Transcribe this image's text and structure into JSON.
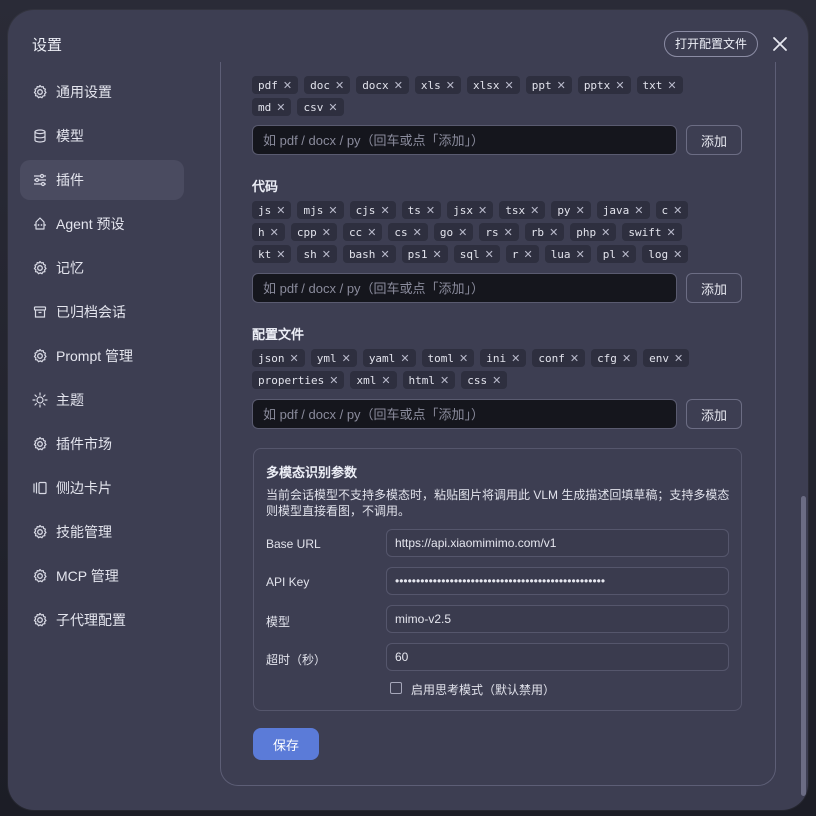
{
  "dialog": {
    "title": "设置",
    "open_config_label": "打开配置文件"
  },
  "sidebar": {
    "items": [
      {
        "label": "通用设置",
        "icon": "gear-icon"
      },
      {
        "label": "模型",
        "icon": "database-icon"
      },
      {
        "label": "插件",
        "icon": "sliders-icon",
        "active": true
      },
      {
        "label": "Agent 预设",
        "icon": "robot-icon"
      },
      {
        "label": "记忆",
        "icon": "gear-icon"
      },
      {
        "label": "已归档会话",
        "icon": "archive-icon"
      },
      {
        "label": "Prompt 管理",
        "icon": "gear-icon"
      },
      {
        "label": "主题",
        "icon": "sun-icon"
      },
      {
        "label": "插件市场",
        "icon": "gear-icon"
      },
      {
        "label": "侧边卡片",
        "icon": "cards-icon"
      },
      {
        "label": "技能管理",
        "icon": "gear-icon"
      },
      {
        "label": "MCP 管理",
        "icon": "gear-icon"
      },
      {
        "label": "子代理配置",
        "icon": "gear-icon"
      }
    ]
  },
  "plugins": {
    "documents": {
      "tags": [
        "pdf",
        "doc",
        "docx",
        "xls",
        "xlsx",
        "ppt",
        "pptx",
        "txt",
        "md",
        "csv"
      ],
      "placeholder": "如 pdf / docx / py（回车或点「添加」）",
      "add_label": "添加"
    },
    "code": {
      "title": "代码",
      "tags": [
        "js",
        "mjs",
        "cjs",
        "ts",
        "jsx",
        "tsx",
        "py",
        "java",
        "c",
        "h",
        "cpp",
        "cc",
        "cs",
        "go",
        "rs",
        "rb",
        "php",
        "swift",
        "kt",
        "sh",
        "bash",
        "ps1",
        "sql",
        "r",
        "lua",
        "pl",
        "log"
      ],
      "placeholder": "如 pdf / docx / py（回车或点「添加」）",
      "add_label": "添加"
    },
    "config": {
      "title": "配置文件",
      "tags": [
        "json",
        "yml",
        "yaml",
        "toml",
        "ini",
        "conf",
        "cfg",
        "env",
        "properties",
        "xml",
        "html",
        "css"
      ],
      "placeholder": "如 pdf / docx / py（回车或点「添加」）",
      "add_label": "添加"
    },
    "multimodal": {
      "title": "多模态识别参数",
      "description": "当前会话模型不支持多模态时，粘贴图片将调用此 VLM 生成描述回填草稿；支持多模态则模型直接看图，不调用。",
      "base_url_label": "Base URL",
      "base_url": "https://api.xiaomimimo.com/v1",
      "api_key_label": "API Key",
      "api_key": "••••••••••••••••••••••••••••••••••••••••••••••••••",
      "model_label": "模型",
      "model": "mimo-v2.5",
      "timeout_label": "超时（秒）",
      "timeout": "60",
      "thinking_label": "启用思考模式（默认禁用）",
      "thinking_enabled": false
    },
    "save_label": "保存"
  },
  "colors": {
    "accent": "#5b7bd8",
    "panel": "#3d3e52",
    "tag_bg": "#2e2f3f"
  }
}
